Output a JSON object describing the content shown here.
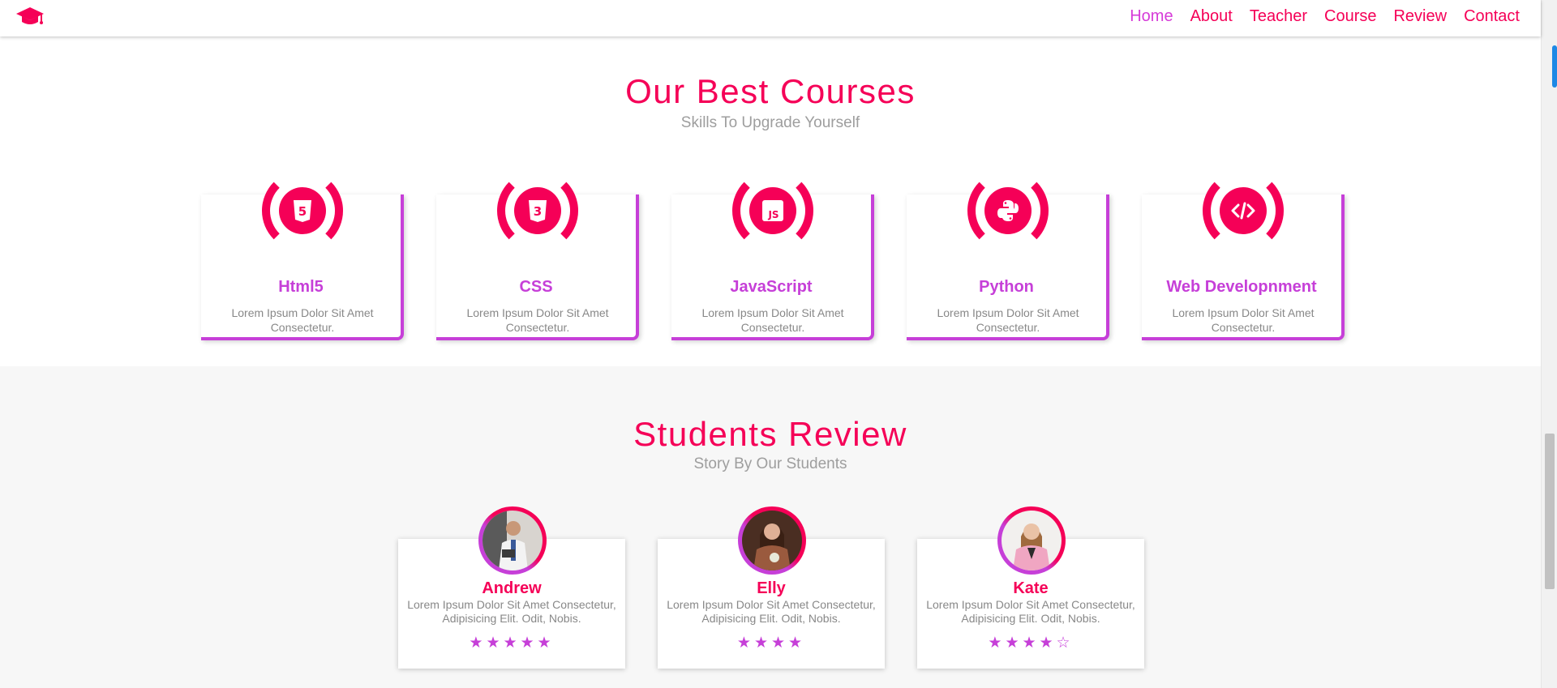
{
  "header": {
    "nav": [
      "Home",
      "About",
      "Teacher",
      "Course",
      "Review",
      "Contact"
    ],
    "active": "Home"
  },
  "courses": {
    "title": "Our Best Courses",
    "subtitle": "Skills To Upgrade Yourself",
    "items": [
      {
        "name": "Html5",
        "icon": "html5-icon",
        "desc": "Lorem Ipsum Dolor Sit Amet Consectetur."
      },
      {
        "name": "CSS",
        "icon": "css3-icon",
        "desc": "Lorem Ipsum Dolor Sit Amet Consectetur."
      },
      {
        "name": "JavaScript",
        "icon": "javascript-icon",
        "desc": "Lorem Ipsum Dolor Sit Amet Consectetur."
      },
      {
        "name": "Python",
        "icon": "python-icon",
        "desc": "Lorem Ipsum Dolor Sit Amet Consectetur."
      },
      {
        "name": "Web Developnment",
        "icon": "code-icon",
        "desc": "Lorem Ipsum Dolor Sit Amet Consectetur."
      }
    ]
  },
  "reviews": {
    "title": "Students Review",
    "subtitle": "Story By Our Students",
    "items": [
      {
        "name": "Andrew",
        "text": "Lorem Ipsum Dolor Sit Amet Consectetur, Adipisicing Elit. Odit, Nobis.",
        "stars": "★★★★★",
        "rating": 5
      },
      {
        "name": "Elly",
        "text": "Lorem Ipsum Dolor Sit Amet Consectetur, Adipisicing Elit. Odit, Nobis.",
        "stars": "★★★★",
        "rating": 4
      },
      {
        "name": "Kate",
        "text": "Lorem Ipsum Dolor Sit Amet Consectetur, Adipisicing Elit. Odit, Nobis.",
        "stars": "★★★★☆",
        "rating": 4.5
      }
    ]
  },
  "colors": {
    "primary": "#f50057",
    "accent": "#c63fd8",
    "text_muted": "#888888"
  }
}
